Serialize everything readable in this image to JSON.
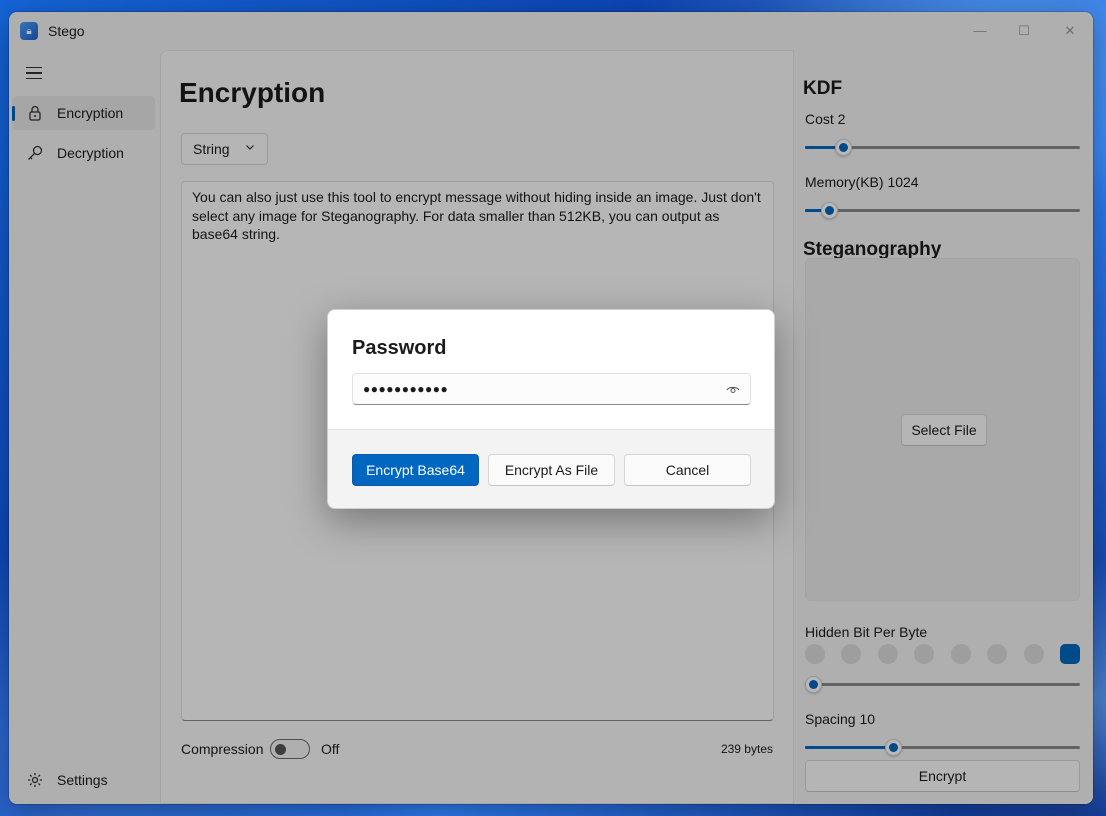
{
  "window": {
    "title": "Stego"
  },
  "nav": {
    "items": [
      {
        "label": "Encryption",
        "icon": "lock-icon",
        "selected": true
      },
      {
        "label": "Decryption",
        "icon": "key-icon",
        "selected": false
      }
    ],
    "settings_label": "Settings"
  },
  "main": {
    "title": "Encryption",
    "input_type": "String",
    "message": "You can also just use this tool to encrypt message without hiding inside an image. Just don't select any image for Steganography. For data smaller than 512KB, you can output as base64 string.",
    "compression_label": "Compression",
    "compression_state": "Off",
    "byte_count": "239 bytes"
  },
  "kdf": {
    "title": "KDF",
    "cost_label": "Cost 2",
    "cost_fraction": 0.14,
    "memory_label": "Memory(KB) 1024",
    "memory_fraction": 0.09
  },
  "steganography": {
    "title": "Steganography",
    "select_file_label": "Select File",
    "hidden_bit_label": "Hidden Bit Per Byte",
    "hidden_bits_total": 8,
    "hidden_bits_selected": 8,
    "hidden_bit_slider_fraction": 0.03,
    "spacing_label": "Spacing 10",
    "spacing_fraction": 0.32,
    "encrypt_label": "Encrypt"
  },
  "dialog": {
    "title": "Password",
    "password_masked": "●●●●●●●●●●●",
    "primary_label": "Encrypt Base64",
    "secondary_label": "Encrypt As File",
    "cancel_label": "Cancel"
  },
  "colors": {
    "accent": "#0067c0"
  }
}
